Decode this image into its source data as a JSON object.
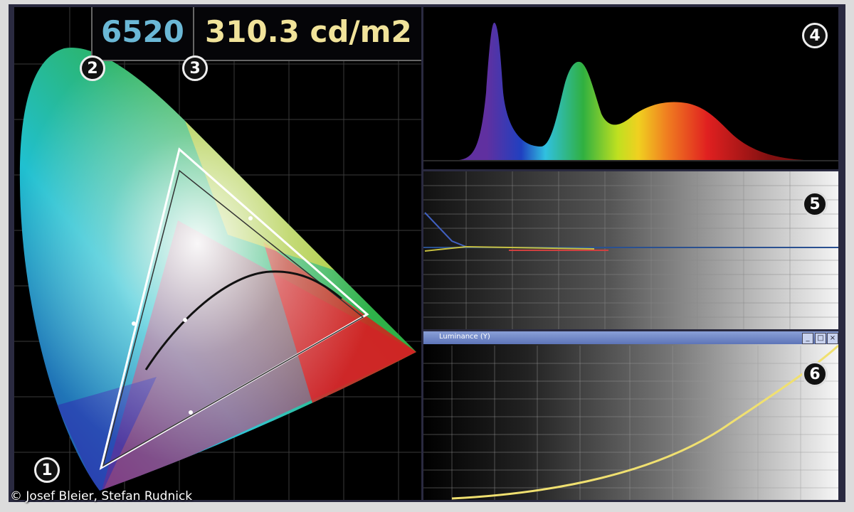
{
  "readout": {
    "cct": "6520",
    "luminance": "310.3 cd/m2"
  },
  "badges": [
    "1",
    "2",
    "3",
    "4",
    "5",
    "6"
  ],
  "credit": "© Josef Bleier, Stefan Rudnick",
  "gamma_window": {
    "title": "Luminance (Y)",
    "buttons": [
      "_",
      "□",
      "×"
    ]
  },
  "colors": {
    "cct": "#6bb8d6",
    "luminance": "#f1e39a",
    "gamut_target": "#ffffff",
    "gamma_curve": "#f0e070"
  },
  "icons": [
    "minimize-icon",
    "maximize-icon",
    "close-icon"
  ]
}
